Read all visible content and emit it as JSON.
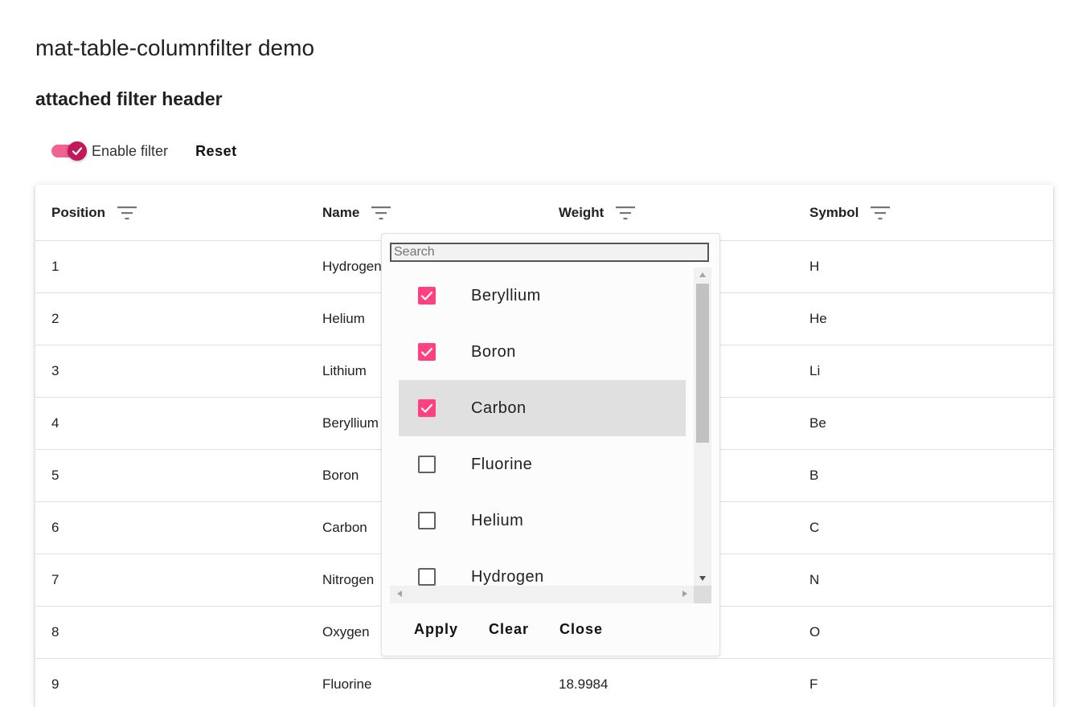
{
  "page": {
    "title": "mat-table-columnfilter demo",
    "section_title": "attached filter header"
  },
  "toolbar": {
    "enable_filter_label": "Enable filter",
    "enable_filter_on": true,
    "reset_label": "Reset"
  },
  "table": {
    "columns": [
      "Position",
      "Name",
      "Weight",
      "Symbol"
    ],
    "rows": [
      {
        "position": "1",
        "name": "Hydrogen",
        "weight": "",
        "symbol": "H"
      },
      {
        "position": "2",
        "name": "Helium",
        "weight": "",
        "symbol": "He"
      },
      {
        "position": "3",
        "name": "Lithium",
        "weight": "",
        "symbol": "Li"
      },
      {
        "position": "4",
        "name": "Beryllium",
        "weight": "",
        "symbol": "Be"
      },
      {
        "position": "5",
        "name": "Boron",
        "weight": "",
        "symbol": "B"
      },
      {
        "position": "6",
        "name": "Carbon",
        "weight": "",
        "symbol": "C"
      },
      {
        "position": "7",
        "name": "Nitrogen",
        "weight": "",
        "symbol": "N"
      },
      {
        "position": "8",
        "name": "Oxygen",
        "weight": "",
        "symbol": "O"
      },
      {
        "position": "9",
        "name": "Fluorine",
        "weight": "18.9984",
        "symbol": "F"
      }
    ]
  },
  "filter_panel": {
    "search_placeholder": "Search",
    "search_value": "",
    "options": [
      {
        "label": "Beryllium",
        "checked": true,
        "active": false
      },
      {
        "label": "Boron",
        "checked": true,
        "active": false
      },
      {
        "label": "Carbon",
        "checked": true,
        "active": true
      },
      {
        "label": "Fluorine",
        "checked": false,
        "active": false
      },
      {
        "label": "Helium",
        "checked": false,
        "active": false
      },
      {
        "label": "Hydrogen",
        "checked": false,
        "active": false
      }
    ],
    "apply_label": "Apply",
    "clear_label": "Clear",
    "close_label": "Close"
  },
  "colors": {
    "accent": "#ff4081",
    "toggle_track": "#f06292",
    "toggle_thumb": "#c2185b",
    "active_option_bg": "#e0e0e0"
  },
  "icons": {
    "column_filter": "filter-list-icon",
    "toggle_check": "check-icon",
    "checkbox_check": "check-icon"
  }
}
